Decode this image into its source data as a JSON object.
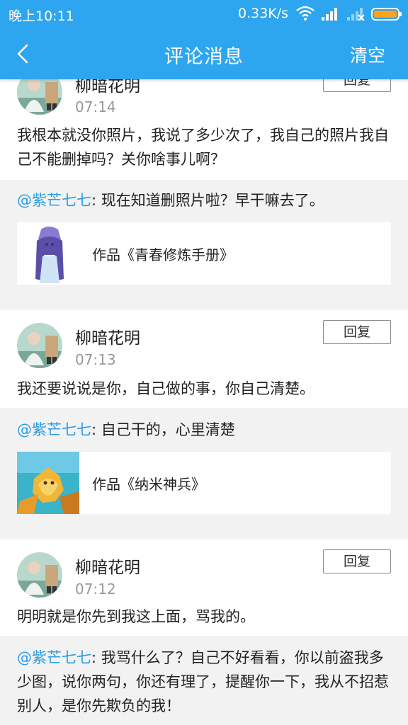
{
  "status_bar": {
    "time": "晚上10:11",
    "speed": "0.33K/s",
    "icons": [
      "wifi-icon",
      "signal-icon",
      "signal-weak-icon",
      "battery-icon"
    ],
    "accent": "#2da5ef"
  },
  "header": {
    "title": "评论消息",
    "clear_label": "清空",
    "back_icon": "chevron-left-icon"
  },
  "comments": [
    {
      "user": "柳暗花明",
      "time": "07:14",
      "reply_label": "回复",
      "text": "我根本就没你照片，我说了多少次了，我自己的照片我自己不能删掉吗？关你啥事儿啊？",
      "quote_user": "@紫芒七七",
      "quote_text": ": 现在知道删照片啦？早干嘛去了。",
      "work_title": "作品《青春修炼手册》"
    },
    {
      "user": "柳暗花明",
      "time": "07:13",
      "reply_label": "回复",
      "text": "我还要说说是你，自己做的事，你自己清楚。",
      "quote_user": "@紫芒七七",
      "quote_text": ": 自己干的，心里清楚",
      "work_title": "作品《纳米神兵》"
    },
    {
      "user": "柳暗花明",
      "time": "07:12",
      "reply_label": "回复",
      "text": "明明就是你先到我这上面，骂我的。",
      "quote_user": "@紫芒七七",
      "quote_text": ": 我骂什么了？自己不好看看，你以前盗我多少图，说你两句，你还有理了，提醒你一下，我从不招惹别人，是你先欺负的我！",
      "work_title": ""
    }
  ]
}
